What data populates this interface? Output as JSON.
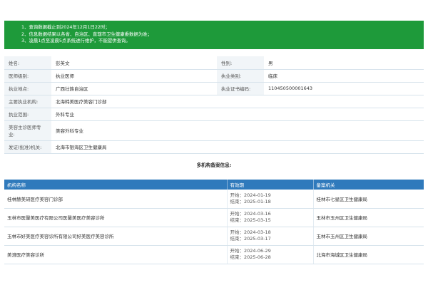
{
  "notice": {
    "lines": [
      "1、查询数据截止到2024年12月1日22时；",
      "2、信息数据结果以各省、自治区、直辖市卫生健康委数据为准；",
      "3、凌晨1点至凌晨5点系统进行维护，不能提供查询。"
    ]
  },
  "info": {
    "name_label": "姓名:",
    "name_value": "彭英文",
    "gender_label": "性别:",
    "gender_value": "男",
    "level_label": "医师级别:",
    "level_value": "执业医师",
    "category_label": "执业类别:",
    "category_value": "临床",
    "location_label": "执业地点:",
    "location_value": "广西壮族自治区",
    "cert_label": "执业证书编码:",
    "cert_value": "110450500001643",
    "main_org_label": "主要执业机构:",
    "main_org_value": "北海韩美医疗美容门诊部",
    "scope_label": "执业范围:",
    "scope_value": "外科专业",
    "beauty_label": "美容主诊医师专业:",
    "beauty_value": "美容外科专业",
    "issuer_label": "发证(批准)机关:",
    "issuer_value": "北海市银海区卫生健康局"
  },
  "multi_title": "多机构备案信息:",
  "orgs": {
    "headers": [
      "机构名称",
      "有效期",
      "备案机关"
    ],
    "start_label": "开始：",
    "end_label": "结束：",
    "rows": [
      {
        "name": "桂林赫美研医疗美容门诊部",
        "start": "2024-01-19",
        "end": "2025-01-18",
        "authority": "桂林市七星区卫生健康局"
      },
      {
        "name": "玉林市医馨美医疗有限公司医馨美医疗美容诊所",
        "start": "2024-03-16",
        "end": "2025-03-15",
        "authority": "玉林市玉州区卫生健康局"
      },
      {
        "name": "玉林市好美医疗美容诊所有限公司好美医疗美容诊所",
        "start": "2024-03-18",
        "end": "2025-03-17",
        "authority": "玉林市玉州区卫生健康局"
      },
      {
        "name": "美澄医疗美容诊所",
        "start": "2024-06-29",
        "end": "2025-06-28",
        "authority": "北海市海城区卫生健康局"
      }
    ]
  },
  "colors": {
    "notice_bg": "#1e9a3a",
    "header_bg": "#2f7abc",
    "label_bg": "#f1f5f8"
  }
}
